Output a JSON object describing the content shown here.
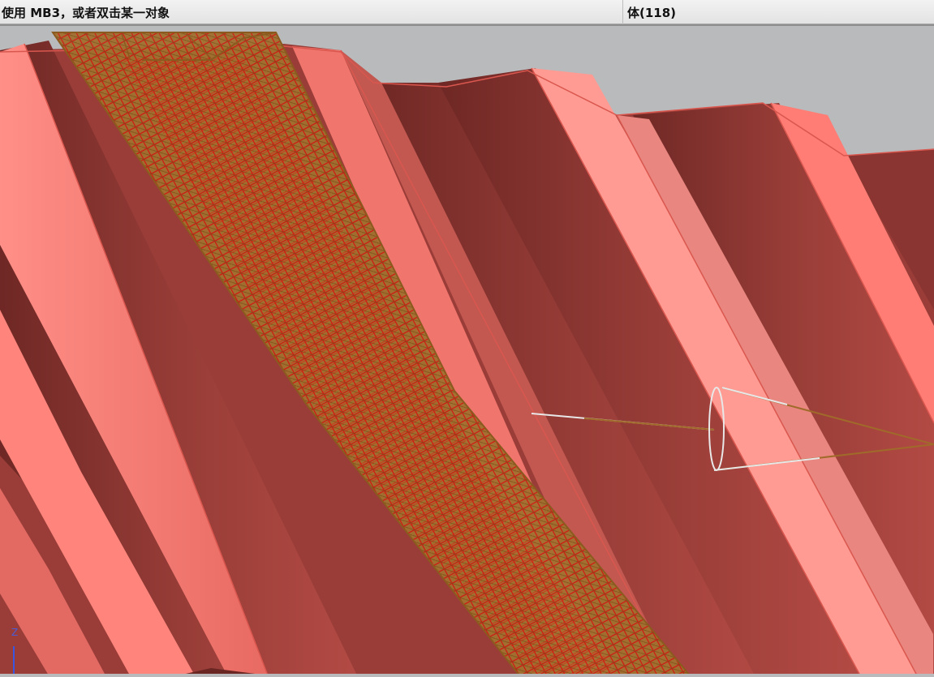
{
  "statusbar": {
    "prompt": "使用 MB3，或者双击某一对象",
    "selection": "体(118)"
  },
  "viewport": {
    "triad_axis_label": "Z",
    "colors": {
      "background": "#b9babc",
      "gear_dark": "#8e3a36",
      "gear_light": "#f07a72",
      "mesh_brown": "#a06a2a",
      "mesh_red": "#e01010",
      "vector_white": "#e8e8e8"
    },
    "icons": [
      "coordinate-triad-icon",
      "vector-cone-icon"
    ]
  }
}
